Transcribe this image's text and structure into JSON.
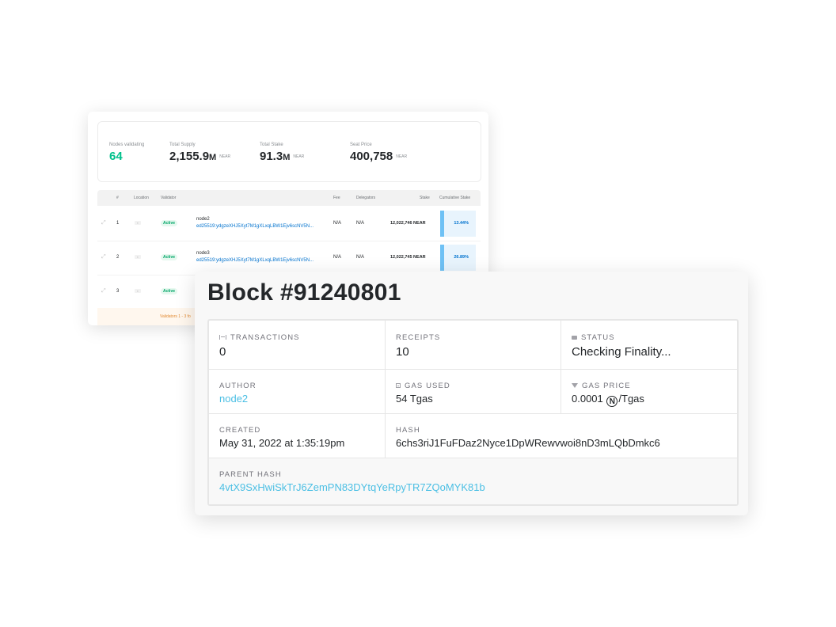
{
  "validators": {
    "stats": {
      "nodes_label": "Nodes validating",
      "nodes_value": "64",
      "supply_label": "Total Supply",
      "supply_value": "2,155.9",
      "supply_suffix": "M",
      "supply_unit": "NEAR",
      "stake_label": "Total Stake",
      "stake_value": "91.3",
      "stake_suffix": "M",
      "stake_unit": "NEAR",
      "seat_label": "Seat Price",
      "seat_value": "400,758",
      "seat_unit": "NEAR"
    },
    "columns": [
      "#",
      "Location",
      "Validator",
      "Fee",
      "Delegators",
      "Stake",
      "Cumulative Stake"
    ],
    "rows": [
      {
        "index": "1",
        "status": "Active",
        "name": "node2",
        "key": "ed25519:ydgzeXHJ5Xyt7M1gXLxqLBW1Ejv6scNV5N...",
        "fee": "N/A",
        "delegators": "N/A",
        "stake": "12,022,746 NEAR",
        "cumulative": "13.44%",
        "cumulative_fraction": 0.1344
      },
      {
        "index": "2",
        "status": "Active",
        "name": "node3",
        "key": "ed25519:ydgzeXHJ5Xyt7M1gXLxqLBW1Ejv6scNV5N...",
        "fee": "N/A",
        "delegators": "N/A",
        "stake": "12,022,745 NEAR",
        "cumulative": "26.89%",
        "cumulative_fraction": 0.2689
      },
      {
        "index": "3",
        "status": "Active"
      }
    ],
    "footer": "Validators 1 - 3 fo"
  },
  "block": {
    "title": "Block #91240801",
    "transactions": {
      "label": "TRANSACTIONS",
      "value": "0",
      "icon": "transactions-icon"
    },
    "receipts": {
      "label": "RECEIPTS",
      "value": "10"
    },
    "status": {
      "label": "STATUS",
      "value": "Checking Finality...",
      "icon": "status-icon"
    },
    "author": {
      "label": "AUTHOR",
      "value": "node2"
    },
    "gas_used": {
      "label": "GAS USED",
      "value": "54 Tgas",
      "icon": "gas-icon"
    },
    "gas_price": {
      "label": "GAS PRICE",
      "value_prefix": "0.0001",
      "near_symbol": "N",
      "value_suffix": "/Tgas",
      "icon": "filter-icon"
    },
    "created": {
      "label": "CREATED",
      "value": "May 31, 2022 at 1:35:19pm"
    },
    "hash": {
      "label": "HASH",
      "value": "6chs3riJ1FuFDaz2Nyce1DpWRewvwoi8nD3mLQbDmkc6"
    },
    "parent_hash": {
      "label": "PARENT HASH",
      "value": "4vtX9SxHwiSkTrJ6ZemPN83DYtqYeRpyTR7ZQoMYK81b"
    }
  },
  "colors": {
    "accent_green": "#00c08b",
    "link_blue": "#4bbfe4",
    "key_blue": "#0072ce",
    "badge_bg": "#e6f8ef"
  }
}
